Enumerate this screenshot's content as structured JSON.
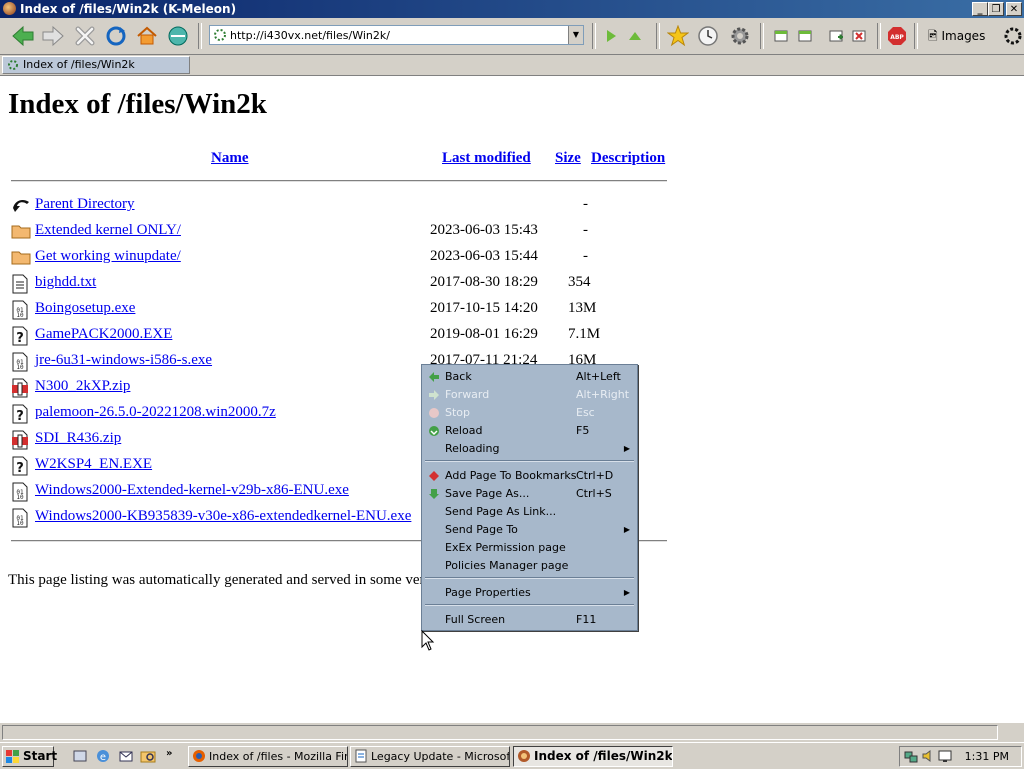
{
  "window": {
    "title": "Index of /files/Win2k (K-Meleon)"
  },
  "toolbar": {
    "url": "http://i430vx.net/files/Win2k/",
    "images_label": "Images"
  },
  "tabs": [
    {
      "label": "Index of /files/Win2k"
    }
  ],
  "page": {
    "heading": "Index of /files/Win2k",
    "columns": {
      "name": "Name",
      "modified": "Last modified",
      "size": "Size",
      "description": "Description"
    },
    "entries": [
      {
        "name": "Parent Directory",
        "modified": "",
        "size": "-",
        "icon": "back-arrow-icon"
      },
      {
        "name": "Extended kernel ONLY/",
        "modified": "2023-06-03 15:43",
        "size": "-",
        "icon": "folder-icon"
      },
      {
        "name": "Get working winupdate/",
        "modified": "2023-06-03 15:44",
        "size": "-",
        "icon": "folder-icon"
      },
      {
        "name": "bighdd.txt",
        "modified": "2017-08-30 18:29",
        "size": "354",
        "icon": "text-file-icon"
      },
      {
        "name": "Boingosetup.exe",
        "modified": "2017-10-15 14:20",
        "size": "13M",
        "icon": "binary-file-icon"
      },
      {
        "name": "GamePACK2000.EXE",
        "modified": "2019-08-01 16:29",
        "size": "7.1M",
        "icon": "unknown-file-icon"
      },
      {
        "name": "jre-6u31-windows-i586-s.exe",
        "modified": "2017-07-11 21:24",
        "size": "16M",
        "icon": "binary-file-icon"
      },
      {
        "name": "N300_2kXP.zip",
        "modified": "",
        "size": "",
        "icon": "compressed-file-icon"
      },
      {
        "name": "palemoon-26.5.0-20221208.win2000.7z",
        "modified": "",
        "size": "",
        "icon": "unknown-file-icon"
      },
      {
        "name": "SDI_R436.zip",
        "modified": "",
        "size": "",
        "icon": "compressed-file-icon"
      },
      {
        "name": "W2KSP4_EN.EXE",
        "modified": "",
        "size": "",
        "icon": "unknown-file-icon"
      },
      {
        "name": "Windows2000-Extended-kernel-v29b-x86-ENU.exe",
        "modified": "",
        "size": "",
        "icon": "binary-file-icon"
      },
      {
        "name": "Windows2000-KB935839-v30e-x86-extendedkernel-ENU.exe",
        "modified": "",
        "size": "",
        "icon": "binary-file-icon"
      }
    ],
    "footer": "This page listing was automatically generated and served in some very"
  },
  "context_menu": {
    "items": [
      {
        "label": "Back",
        "shortcut": "Alt+Left",
        "disabled": false,
        "icon": "back-arrow-icon"
      },
      {
        "label": "Forward",
        "shortcut": "Alt+Right",
        "disabled": true,
        "icon": "forward-arrow-icon"
      },
      {
        "label": "Stop",
        "shortcut": "Esc",
        "disabled": true,
        "icon": "stop-icon"
      },
      {
        "label": "Reload",
        "shortcut": "F5",
        "disabled": false,
        "icon": "reload-icon"
      },
      {
        "label": "Reloading",
        "shortcut": "",
        "submenu": true
      },
      {
        "label": "Add Page To Bookmarks",
        "shortcut": "Ctrl+D",
        "icon": "bookmark-add-icon"
      },
      {
        "label": "Save Page As...",
        "shortcut": "Ctrl+S",
        "icon": "save-icon"
      },
      {
        "label": "Send Page As Link...",
        "shortcut": ""
      },
      {
        "label": "Send Page To",
        "shortcut": "",
        "submenu": true
      },
      {
        "label": "ExEx Permission page",
        "shortcut": ""
      },
      {
        "label": "Policies Manager page",
        "shortcut": ""
      },
      {
        "label": "Page Properties",
        "shortcut": "",
        "submenu": true
      },
      {
        "label": "Full Screen",
        "shortcut": "F11"
      }
    ]
  },
  "taskbar": {
    "start_label": "Start",
    "tasks": [
      {
        "label": "Index of /files - Mozilla Fire..."
      },
      {
        "label": "Legacy Update - Microsoft..."
      },
      {
        "label": "Index of /files/Win2k..."
      }
    ],
    "clock": "1:31 PM"
  }
}
